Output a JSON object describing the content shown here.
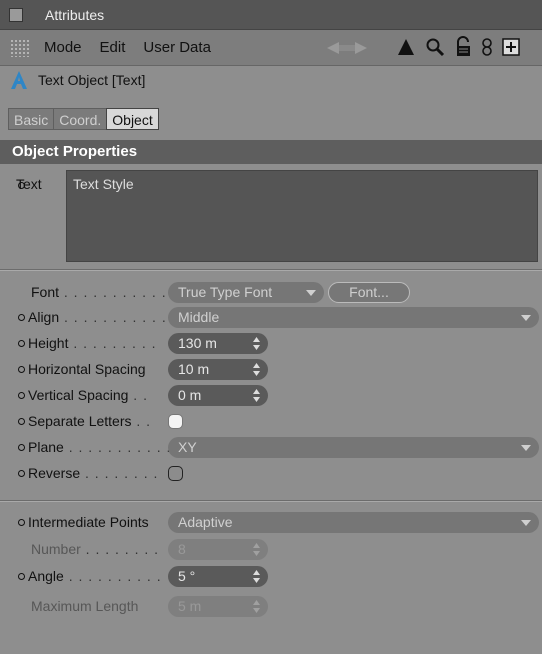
{
  "window": {
    "title": "Attributes"
  },
  "menu": {
    "items": [
      "Mode",
      "Edit",
      "User Data"
    ]
  },
  "toolbar_icons": [
    "arrow-icon",
    "search-icon",
    "lock-icon",
    "link-icon",
    "new-panel-icon"
  ],
  "object": {
    "title": "Text Object [Text]"
  },
  "tabs": {
    "basic": "Basic",
    "coord": "Coord.",
    "object": "Object"
  },
  "section": {
    "title": "Object Properties"
  },
  "text_field": {
    "label": "Text",
    "value": "Text Style"
  },
  "font_row": {
    "label": "Font",
    "dots": " . . . . . . . . . . . .",
    "type_value": "True Type Font",
    "font_button": "Font..."
  },
  "align_row": {
    "label": "Align",
    "dots": " . . . . . . . . . . .",
    "value": "Middle"
  },
  "height_row": {
    "label": "Height",
    "dots": " . . . . . . . . .",
    "value": "130 m"
  },
  "hspacing_row": {
    "label": "Horizontal Spacing",
    "value": "10 m"
  },
  "vspacing_row": {
    "label": "Vertical Spacing",
    "dots": " . .",
    "value": "0 m"
  },
  "separate_row": {
    "label": "Separate Letters",
    "dots": " . .",
    "checked": false
  },
  "plane_row": {
    "label": "Plane",
    "dots": " . . . . . . . . . . .",
    "value": "XY"
  },
  "reverse_row": {
    "label": "Reverse",
    "dots": " . . . . . . . .",
    "checked": false
  },
  "intermediate_row": {
    "label": "Intermediate Points",
    "value": "Adaptive"
  },
  "number_row": {
    "label": "Number",
    "dots": " . . . . . . . .",
    "value": "8"
  },
  "angle_row": {
    "label": "Angle",
    "dots": " . . . . . . . . . .",
    "value": "5 °"
  },
  "maxlen_row": {
    "label": "Maximum Length",
    "value": "5 m"
  }
}
